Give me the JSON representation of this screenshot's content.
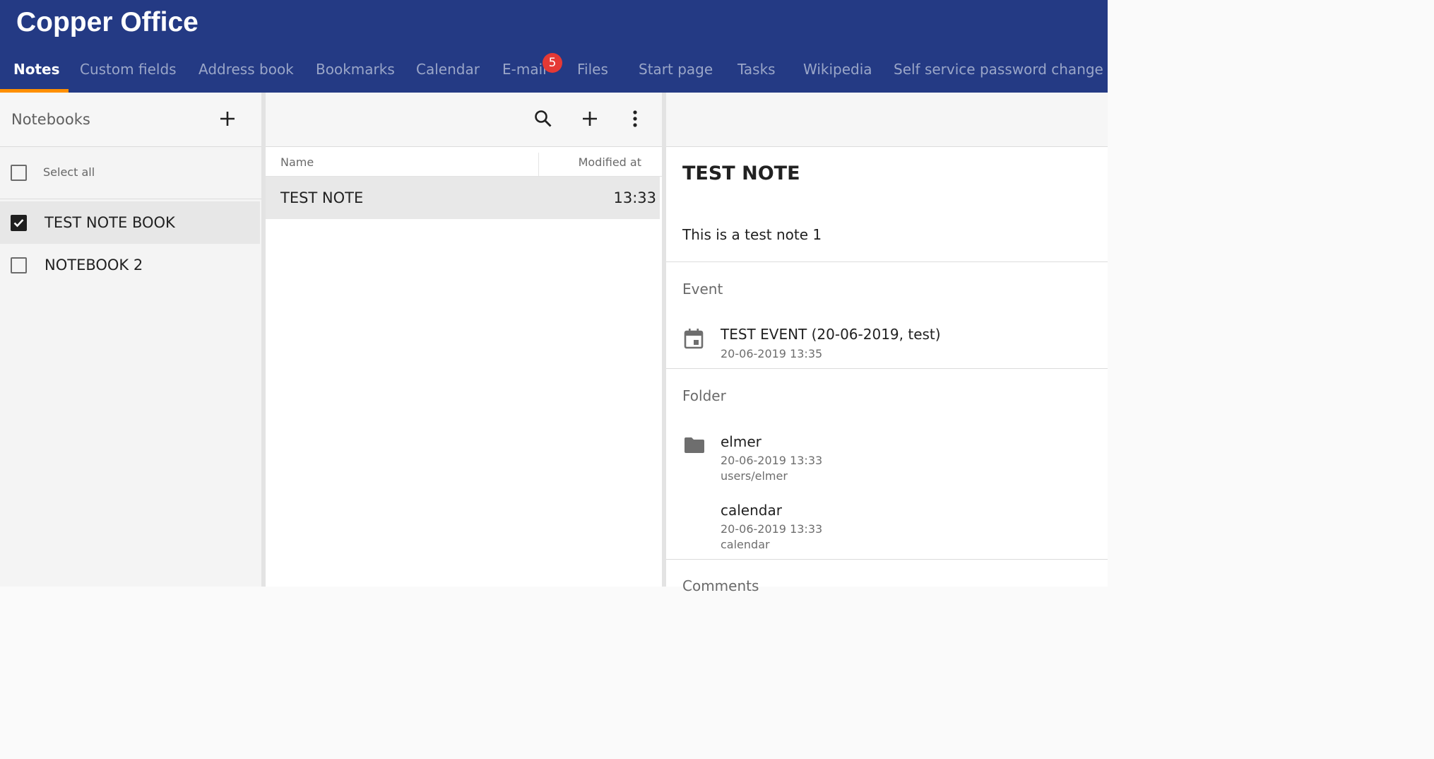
{
  "app": {
    "title": "Copper Office"
  },
  "tabs": [
    {
      "label": "Notes"
    },
    {
      "label": "Custom fields"
    },
    {
      "label": "Address book"
    },
    {
      "label": "Bookmarks"
    },
    {
      "label": "Calendar"
    },
    {
      "label": "E-mail",
      "badge": "5"
    },
    {
      "label": "Files"
    },
    {
      "label": "Start page"
    },
    {
      "label": "Tasks"
    },
    {
      "label": "Wikipedia"
    },
    {
      "label": "Self service password change"
    }
  ],
  "colors": {
    "header": "#243a84",
    "active_indicator": "#ff8f00",
    "badge": "#e53935"
  },
  "notebooks": {
    "title": "Notebooks",
    "add_icon": "plus-icon",
    "select_all": "Select all",
    "items": [
      {
        "label": "TEST NOTE BOOK",
        "checked": true
      },
      {
        "label": "NOTEBOOK 2",
        "checked": false
      }
    ]
  },
  "notes_list": {
    "toolbar_icons": [
      "search-icon",
      "plus-icon",
      "more-vert-icon"
    ],
    "columns": {
      "name": "Name",
      "modified": "Modified at"
    },
    "rows": [
      {
        "name": "TEST NOTE",
        "modified": "13:33"
      }
    ]
  },
  "note_detail": {
    "title": "TEST NOTE",
    "body": "This is a test note 1",
    "event_section": {
      "label": "Event",
      "items": [
        {
          "title": "TEST EVENT (20-06-2019, test)",
          "date": "20-06-2019 13:35",
          "icon": "calendar-icon"
        }
      ]
    },
    "folder_section": {
      "label": "Folder",
      "items": [
        {
          "title": "elmer",
          "date": "20-06-2019 13:33",
          "path": "users/elmer",
          "icon": "folder-icon"
        },
        {
          "title": "calendar",
          "date": "20-06-2019 13:33",
          "path": "calendar"
        }
      ]
    },
    "comments_section": {
      "label": "Comments"
    }
  }
}
